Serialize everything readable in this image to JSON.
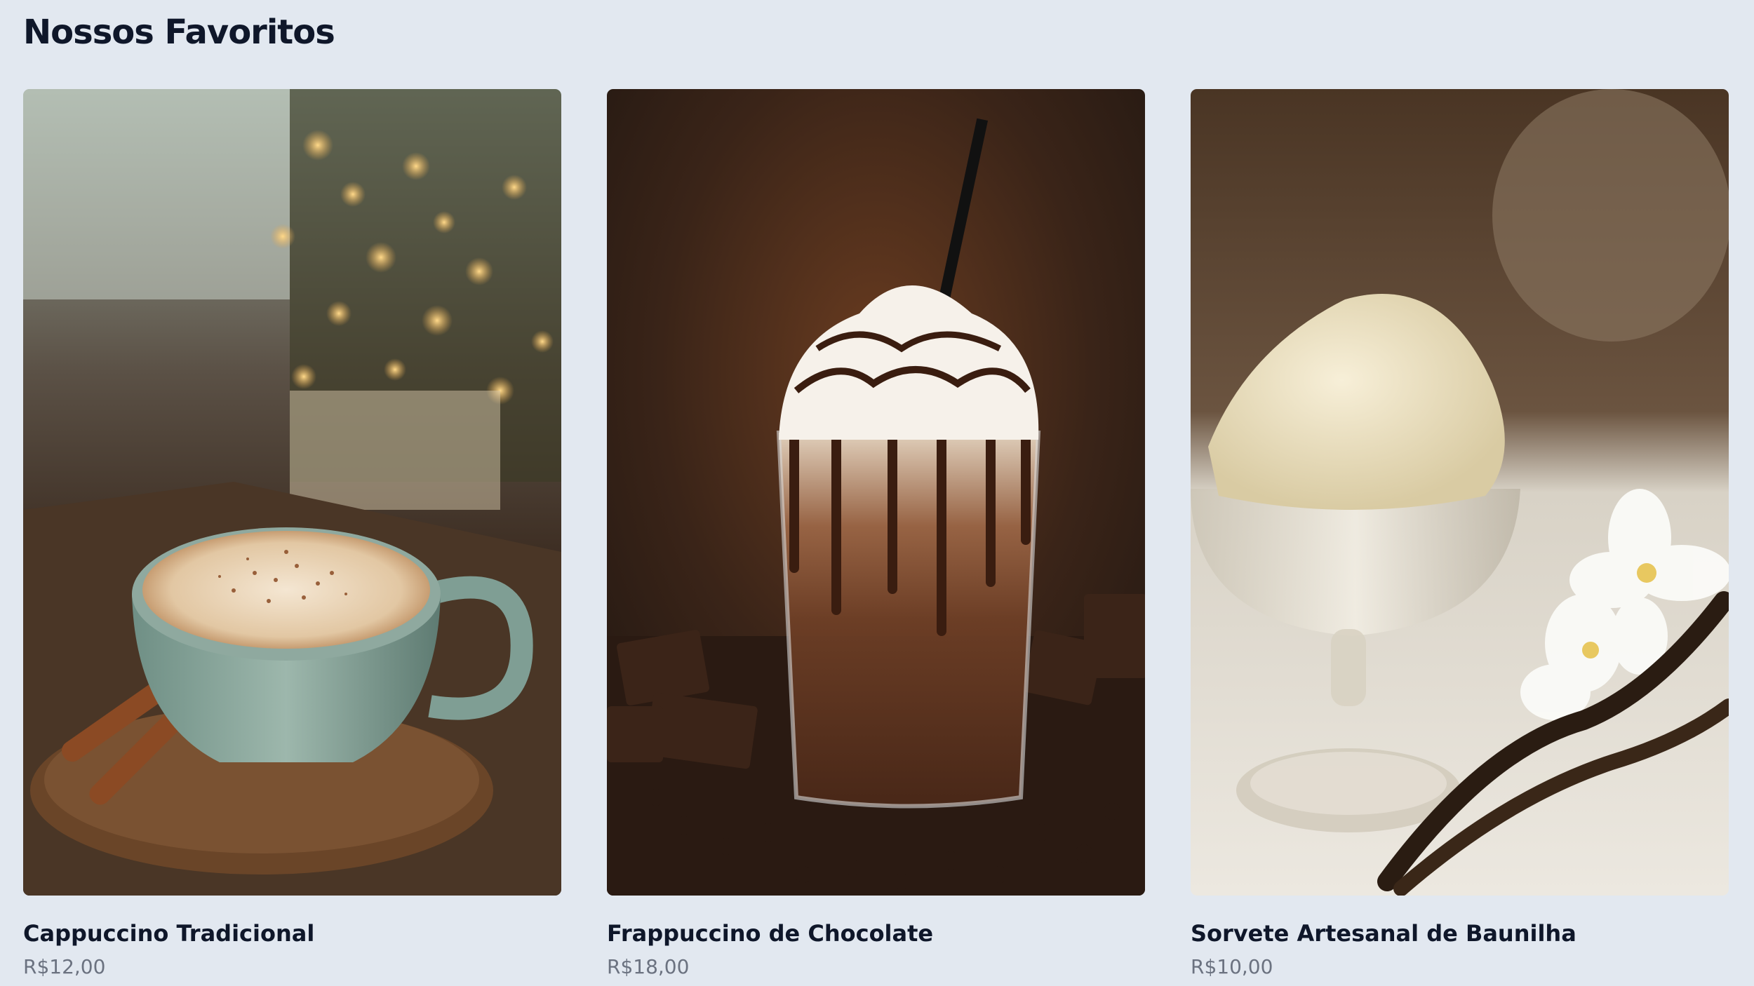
{
  "section": {
    "title": "Nossos Favoritos"
  },
  "products": [
    {
      "name": "Cappuccino Tradicional",
      "price": "R$12,00",
      "image_icon": "cappuccino-photo"
    },
    {
      "name": "Frappuccino de Chocolate",
      "price": "R$18,00",
      "image_icon": "chocolate-frappuccino-photo"
    },
    {
      "name": "Sorvete Artesanal de Baunilha",
      "price": "R$10,00",
      "image_icon": "vanilla-ice-cream-photo"
    }
  ],
  "colors": {
    "background": "#e2e8f0",
    "title": "#0f172a",
    "price": "#6b7280"
  }
}
